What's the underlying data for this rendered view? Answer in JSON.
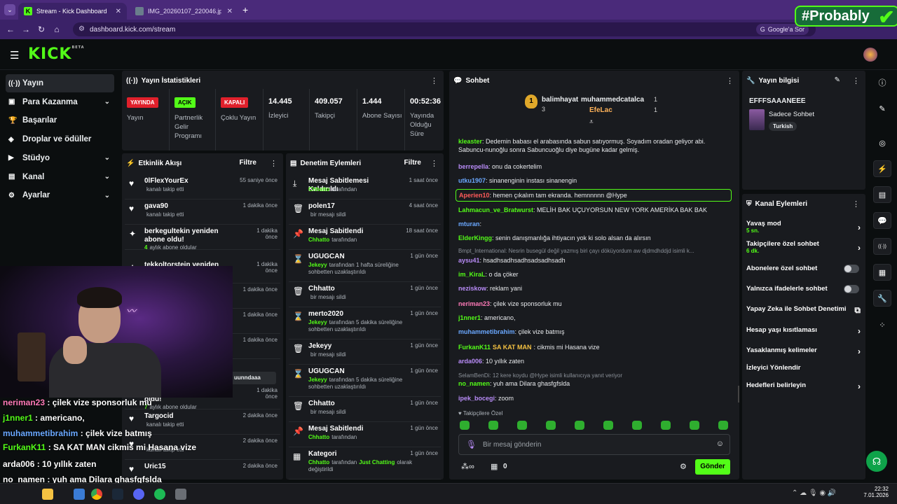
{
  "browser": {
    "tabs": [
      {
        "title": "Stream - Kick Dashboard",
        "active": true
      },
      {
        "title": "IMG_20260107_220046.jpg (91",
        "active": false
      }
    ],
    "new_tab": "+",
    "url": "dashboard.kick.com/stream",
    "google_search": "Google'a Sor",
    "watermark": "#Probably"
  },
  "kick": {
    "logo": "KICK",
    "beta": "BETA"
  },
  "sidebar": {
    "items": [
      {
        "label": "Yayın",
        "icon": "broadcast-icon",
        "active": true
      },
      {
        "label": "Para Kazanma",
        "icon": "money-icon",
        "chevron": true
      },
      {
        "label": "Başarılar",
        "icon": "trophy-icon"
      },
      {
        "label": "Droplar ve ödüller",
        "icon": "gift-icon"
      },
      {
        "label": "Stüdyo",
        "icon": "video-icon",
        "chevron": true
      },
      {
        "label": "Kanal",
        "icon": "channel-icon",
        "chevron": true
      },
      {
        "label": "Ayarlar",
        "icon": "gear-icon",
        "chevron": true
      }
    ]
  },
  "stats": {
    "title": "Yayın İstatistikleri",
    "cols": [
      {
        "badge": "YAYINDA",
        "badge_color": "#e0202b",
        "label": "Yayın"
      },
      {
        "badge": "AÇIK",
        "badge_color": "#53fc18",
        "label": "Partnerlik Gelir Programı"
      },
      {
        "badge": "KAPALI",
        "badge_color": "#e0202b",
        "label": "Çoklu Yayın"
      },
      {
        "value": "14.445",
        "label": "İzleyici"
      },
      {
        "value": "409.057",
        "label": "Takipçi"
      },
      {
        "value": "1.444",
        "label": "Abone Sayısı"
      },
      {
        "value": "00:52:36",
        "label": "Yayında Olduğu Süre"
      }
    ]
  },
  "activity": {
    "title": "Etkinlik Akışı",
    "filter": "Filtre",
    "items": [
      {
        "name": "0lFlexYourEx",
        "sub": "kanalı takip etti",
        "time": "55 saniye önce",
        "icon": "heart-icon"
      },
      {
        "name": "gava90",
        "sub": "kanalı takip etti",
        "time": "1 dakika önce",
        "icon": "heart-icon"
      },
      {
        "name": "berkegultekin yeniden abone oldu!",
        "sub_num": "4",
        "sub": "aylık abone oldular",
        "time": "1 dakika önce",
        "icon": "sparkle-icon"
      },
      {
        "name": "tekkoltorstein yeniden abone",
        "sub": "",
        "time": "1 dakika önce",
        "icon": "sparkle-icon"
      },
      {
        "name": "",
        "sub": "",
        "time": "1 dakika önce",
        "icon": ""
      },
      {
        "name": "",
        "sub": "",
        "time": "1 dakika önce",
        "icon": ""
      },
      {
        "name": "",
        "sub": "plam abonelik",
        "time": "1 dakika önce",
        "icon": ""
      },
      {
        "name": "Chabler yeniden abone oldu!",
        "sub_num": "7",
        "sub": "aylık abone oldular",
        "time": "1 dakika önce",
        "icon": "sparkle-icon"
      },
      {
        "name": "Targocid",
        "sub": "kanalı takip etti",
        "time": "2 dakika önce",
        "icon": "heart-icon"
      },
      {
        "name": "",
        "sub": "kanalı takip etti",
        "time": "2 dakika önce",
        "icon": "heart-icon"
      },
      {
        "name": "Uric15",
        "sub": "",
        "time": "2 dakika önce",
        "icon": "heart-icon"
      }
    ],
    "partial_chip": "uunndaaa"
  },
  "moderation": {
    "title": "Denetim Eylemleri",
    "filter": "Filtre",
    "items": [
      {
        "name": "Mesaj Sabitlemesi Kaldırıldı",
        "actor": "Chhatto",
        "sub": "tarafından",
        "time": "1 saat önce",
        "icon": "unpin-icon"
      },
      {
        "name": "polen17",
        "actor": "",
        "sub": "bir mesajı sildi",
        "time": "4 saat önce",
        "icon": "trash-icon"
      },
      {
        "name": "Mesaj Sabitlendi",
        "actor": "Chhatto",
        "sub": "tarafından",
        "time": "18 saat önce",
        "icon": "pin-icon"
      },
      {
        "name": "UGUGCAN",
        "actor": "Jekeyy",
        "sub": "tarafından 1 hafta süreliğine sohbetten uzaklaştırıldı",
        "time": "1 gün önce",
        "icon": "hourglass-icon"
      },
      {
        "name": "Chhatto",
        "actor": "",
        "sub": "bir mesajı sildi",
        "time": "1 gün önce",
        "icon": "trash-icon"
      },
      {
        "name": "merto2020",
        "actor": "Jekeyy",
        "sub": "tarafından 5 dakika süreliğine sohbetten uzaklaştırıldı",
        "time": "1 gün önce",
        "icon": "hourglass-icon"
      },
      {
        "name": "Jekeyy",
        "actor": "",
        "sub": "bir mesajı sildi",
        "time": "1 gün önce",
        "icon": "trash-icon"
      },
      {
        "name": "UGUGCAN",
        "actor": "Jekeyy",
        "sub": "tarafından 5 dakika süreliğine sohbetten uzaklaştırıldı",
        "time": "1 gün önce",
        "icon": "hourglass-icon"
      },
      {
        "name": "Chhatto",
        "actor": "",
        "sub": "bir mesajı sildi",
        "time": "1 gün önce",
        "icon": "trash-icon"
      },
      {
        "name": "Mesaj Sabitlendi",
        "actor": "Chhatto",
        "sub": "tarafından",
        "time": "1 gün önce",
        "icon": "pin-icon"
      },
      {
        "name": "Kategori",
        "actor": "Chhatto",
        "sub": "tarafından",
        "extra": "Just Chatting",
        "sub2": "olarak değiştirildi",
        "time": "1 gün önce",
        "icon": "category-icon"
      }
    ]
  },
  "chat": {
    "title": "Sohbet",
    "top": [
      {
        "rank": "1",
        "name": "balimhayat",
        "count": "3"
      },
      {
        "rank": "",
        "name": "muhammedcatalca",
        "count": "1"
      },
      {
        "rank": "",
        "name": "EfeLac",
        "count": "1"
      }
    ],
    "messages": [
      {
        "user": "kleaster",
        "color": "#53fc18",
        "text": ": Dedemin babası el arabasında sabun satıyormuş. Soyadım oradan geliyor abi. Sabuncu-nunoğlu sonra Sabuncuoğlu diye bugüne kadar gelmiş."
      },
      {
        "user": "berrepella",
        "color": "#b98cf8",
        "text": ": onu da cokertelim"
      },
      {
        "user": "utku1907",
        "color": "#6aa8ff",
        "text": ": sinanenginin instası sinanengin"
      },
      {
        "user": "Aperien10",
        "color": "#ff5a5a",
        "text": ": hemen çıkalım tam ekranda. hemnnnnn @Hype",
        "highlight": true
      },
      {
        "user": "Lahmacun_ve_Bratwurst",
        "color": "#53fc18",
        "text": ": MELİH BAK UÇUYORSUN NEW YORK AMERİKA BAK BAK"
      },
      {
        "user": "mturan",
        "color": "#6aa8ff",
        "text": ":"
      },
      {
        "user": "ElderKingg",
        "color": "#53fc18",
        "text": ": senin danışmanlığa ihtiyacın yok ki solo alsan da alırsın"
      },
      {
        "user": "",
        "color": "#8a9098",
        "text": "Bmpt_International: Nesrin busegül değil yazmış biri çayı döküyordum aw djdmdhddjd isimli k...",
        "system": true
      },
      {
        "user": "aysu41",
        "color": "#b98cf8",
        "text": ": hsadhsadhsadhsadsadhsadh"
      },
      {
        "user": "im_KiraL",
        "color": "#53fc18",
        "text": ": o da çöker"
      },
      {
        "user": "neziskow",
        "color": "#b98cf8",
        "text": ": reklam yani"
      },
      {
        "user": "neriman23",
        "color": "#ff7ab8",
        "text": ": çilek vize sponsorluk mu"
      },
      {
        "user": "j1nner1",
        "color": "#53fc18",
        "text": ": americano,"
      },
      {
        "user": "muhammetibrahim",
        "color": "#6aa8ff",
        "text": ": çilek vize batmış"
      },
      {
        "user": "FurkanK11",
        "color": "#53fc18",
        "text": ": cikmis mi Hasana vize",
        "emote": "SA KAT MAN"
      },
      {
        "user": "arda006",
        "color": "#b98cf8",
        "text": ": 10 yıllık zaten"
      },
      {
        "user": "",
        "color": "#8a9098",
        "text": "SelamBenDi: 12 kere koydu @Hype isimli kullanıcıya yanıt veriyor",
        "system": true
      },
      {
        "user": "no_namen",
        "color": "#53fc18",
        "text": ": yuh ama Dilara ghasfgfslda"
      },
      {
        "user": "ipek_bocegi",
        "color": "#b98cf8",
        "text": ": zoom"
      }
    ],
    "followers_only": "Takipçilere Özel",
    "input_placeholder": "Bir mesaj gönderin",
    "points": "0",
    "send": "Gönder"
  },
  "stream_info": {
    "title": "Yayın bilgisi",
    "stream_title": "EFFFSAAANEEE",
    "category": "Sadece Sohbet",
    "tag": "Turkish"
  },
  "channel_actions": {
    "title": "Kanal Eylemleri",
    "items": [
      {
        "label": "Yavaş mod",
        "sub": "5 sn.",
        "kind": "arrow"
      },
      {
        "label": "Takipçilere özel sohbet",
        "sub": "6 dk.",
        "kind": "arrow"
      },
      {
        "label": "Abonelere özel sohbet",
        "kind": "toggle"
      },
      {
        "label": "Yalnızca ifadelerle sohbet",
        "kind": "toggle"
      },
      {
        "label": "Yapay Zeka ile Sohbet Denetimi",
        "kind": "external"
      },
      {
        "label": "Hesap yaşı kısıtlaması",
        "kind": "arrow"
      },
      {
        "label": "Yasaklanmış kelimeler",
        "kind": "arrow"
      },
      {
        "label": "İzleyici Yönlendir",
        "kind": "none"
      },
      {
        "label": "Hedefleri belirleyin",
        "kind": "arrow"
      }
    ]
  },
  "overlay_chat": [
    {
      "user": "neriman23",
      "color": "#ff7ab8",
      "text": " : çilek vize sponsorluk mu"
    },
    {
      "user": "j1nner1",
      "color": "#53fc18",
      "text": " : americano,"
    },
    {
      "user": "muhammetibrahim",
      "color": "#6aa8ff",
      "text": " : çilek vize batmış"
    },
    {
      "user": "FurkanK11",
      "color": "#53fc18",
      "text": " : SA KAT MAN cikmis mi Hasana vize"
    },
    {
      "user": "arda006",
      "color": "#ffffff",
      "text": " : 10 yıllık zaten"
    },
    {
      "user": "no_namen",
      "color": "#ffffff",
      "text": " : yuh ama Dilara ghasfgfslda"
    },
    {
      "user": "ipek_bocegi",
      "color": "#b98cf8",
      "text": " : zoom"
    }
  ],
  "taskbar": {
    "time": "22:32",
    "date": "7.01.2026"
  }
}
